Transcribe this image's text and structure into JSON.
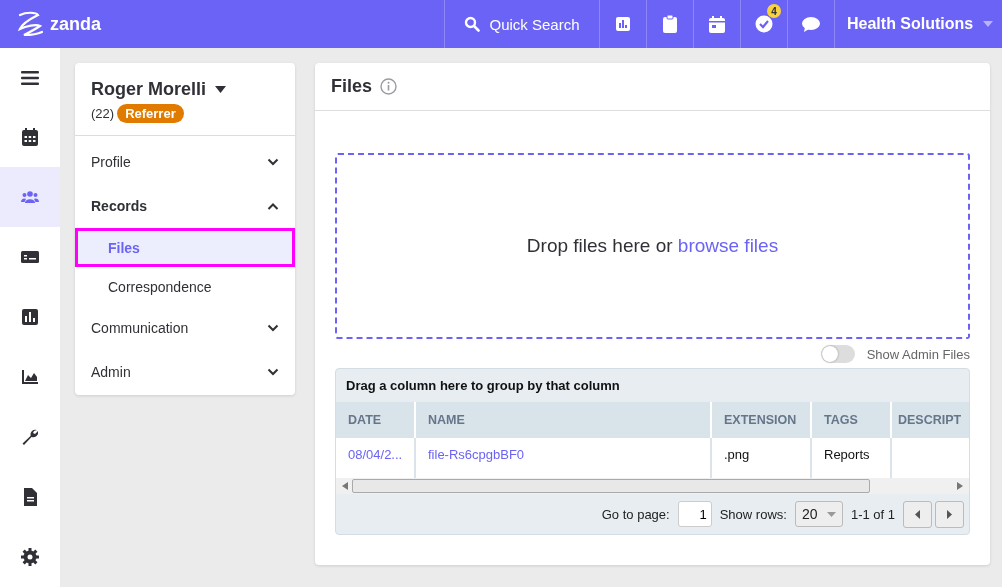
{
  "topbar": {
    "logo": "zanda",
    "search": "Quick Search",
    "notification_count": "4",
    "account": "Health Solutions"
  },
  "rail": [
    {
      "selected": false
    },
    {
      "selected": false
    },
    {
      "selected": true
    },
    {
      "selected": false
    },
    {
      "selected": false
    },
    {
      "selected": false
    },
    {
      "selected": false
    },
    {
      "selected": false
    },
    {
      "selected": false
    }
  ],
  "contact": {
    "name": "Roger Morelli",
    "count": "(22)",
    "tag": "Referrer"
  },
  "nav": [
    {
      "label": "Profile",
      "expanded": false
    },
    {
      "label": "Records",
      "expanded": true,
      "children": [
        {
          "label": "Files",
          "selected": true
        },
        {
          "label": "Correspondence",
          "selected": false
        }
      ]
    },
    {
      "label": "Communication",
      "expanded": false
    },
    {
      "label": "Admin",
      "expanded": false
    }
  ],
  "panel": {
    "title": "Files",
    "drop_text": "Drop files here or ",
    "drop_link": "browse files",
    "admin_toggle": {
      "label": "Show Admin Files",
      "on": false
    }
  },
  "table": {
    "group_hint": "Drag a column here to group by that column",
    "columns": [
      "DATE",
      "NAME",
      "EXTENSION",
      "TAGS",
      "DESCRIPT"
    ],
    "rows": [
      [
        {
          "text": "08/04/2...",
          "link": true
        },
        {
          "text": "file-Rs6cpgbBF0",
          "link": true
        },
        {
          "text": ".png",
          "link": false
        },
        {
          "text": "Reports",
          "link": false
        }
      ]
    ],
    "pager": {
      "goto_label": "Go to page:",
      "page": "1",
      "rows_label": "Show rows:",
      "rows": "20",
      "range": "1-1 of 1"
    }
  }
}
